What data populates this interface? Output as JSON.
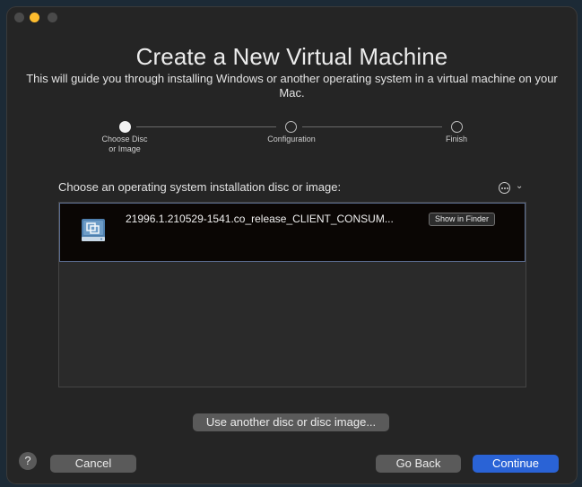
{
  "window": {
    "title": "Create a New Virtual Machine",
    "subtitle": "This will guide you through installing Windows or another operating system in a virtual machine on your Mac."
  },
  "steps": [
    {
      "label": "Choose Disc\nor Image",
      "active": true
    },
    {
      "label": "Configuration",
      "active": false
    },
    {
      "label": "Finish",
      "active": false
    }
  ],
  "chooser": {
    "label": "Choose an operating system installation disc or image:",
    "options_icon": "ellipsis-circle-icon",
    "items": [
      {
        "name": "21996.1.210529-1541.co_release_CLIENT_CONSUM...",
        "icon": "disc-image-icon",
        "action_label": "Show in Finder"
      }
    ]
  },
  "buttons": {
    "another": "Use another disc or disc image...",
    "cancel": "Cancel",
    "back": "Go Back",
    "continue": "Continue",
    "help": "?"
  },
  "colors": {
    "accent": "#2a63d6",
    "minimize": "#fdbc2e",
    "selection_border": "#5a6c8f"
  }
}
